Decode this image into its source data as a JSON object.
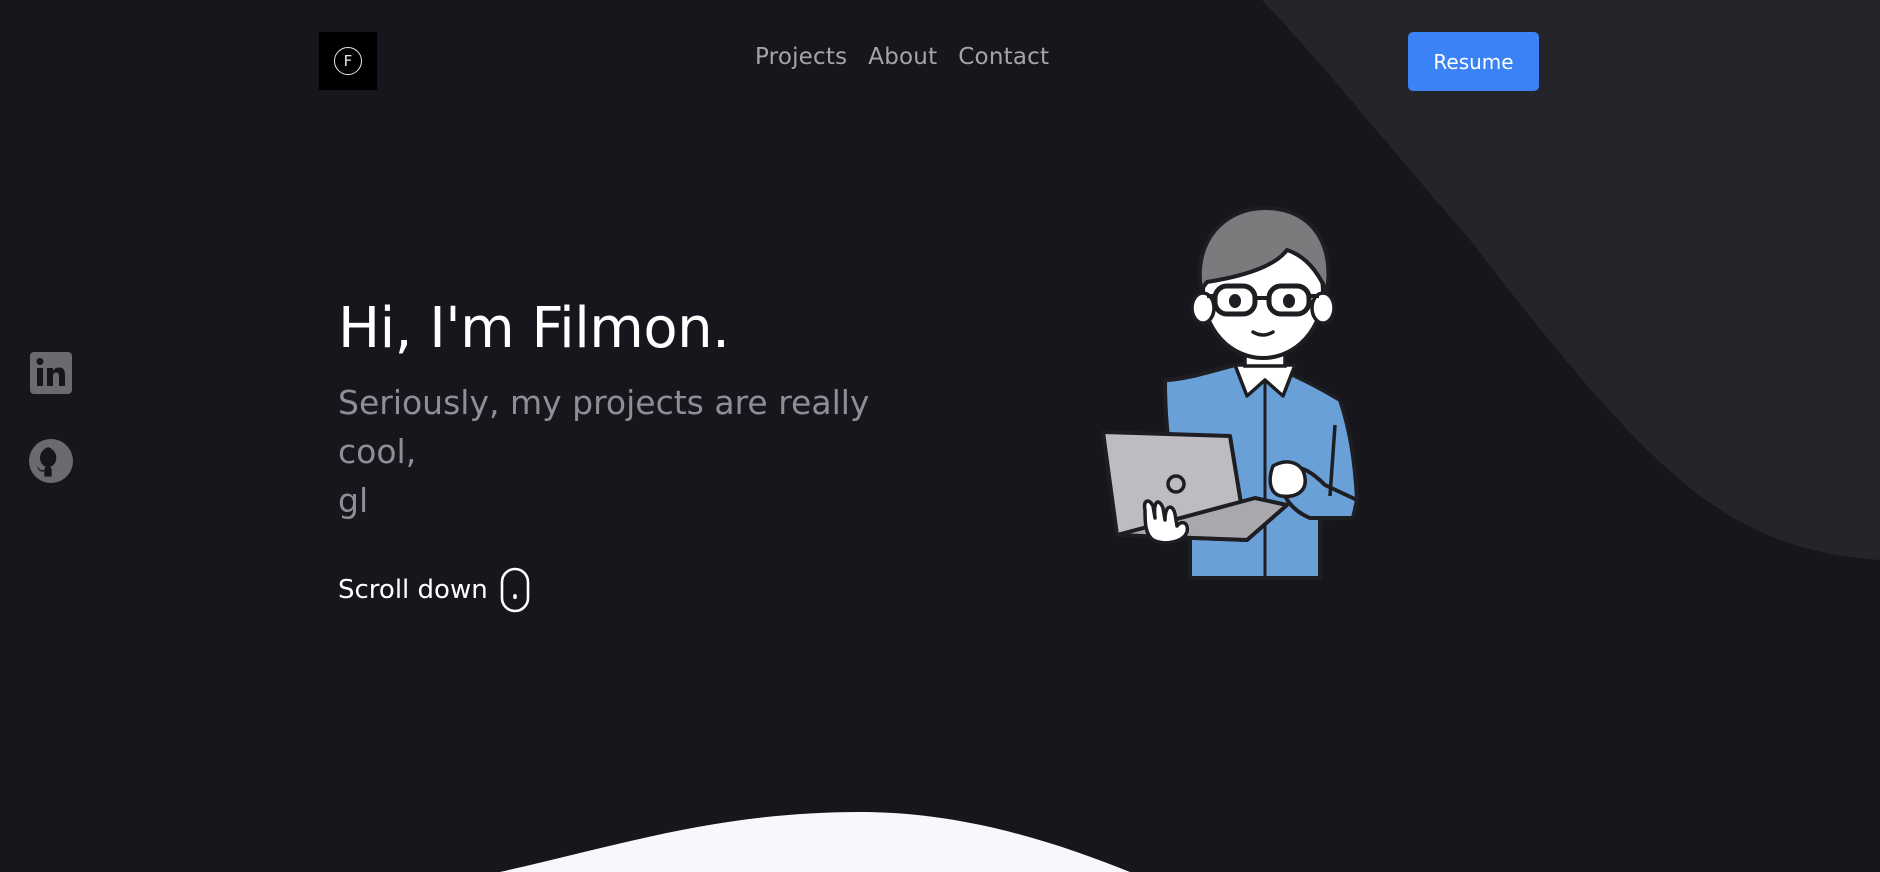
{
  "header": {
    "logo_letter": "F",
    "nav": [
      {
        "label": "Projects"
      },
      {
        "label": "About"
      },
      {
        "label": "Contact"
      }
    ],
    "resume_label": "Resume"
  },
  "social": {
    "linkedin_icon": "linkedin-icon",
    "github_icon": "github-icon"
  },
  "hero": {
    "title": "Hi, I'm Filmon.",
    "subtitle_line1": "Seriously, my projects are really cool,",
    "subtitle_line2": "gl",
    "scroll_label": "Scroll down",
    "scroll_icon": "mouse-icon"
  },
  "colors": {
    "background": "#17161c",
    "accent_shape": "#25242b",
    "button": "#3b82f6",
    "wave": "#f8f8fc"
  }
}
